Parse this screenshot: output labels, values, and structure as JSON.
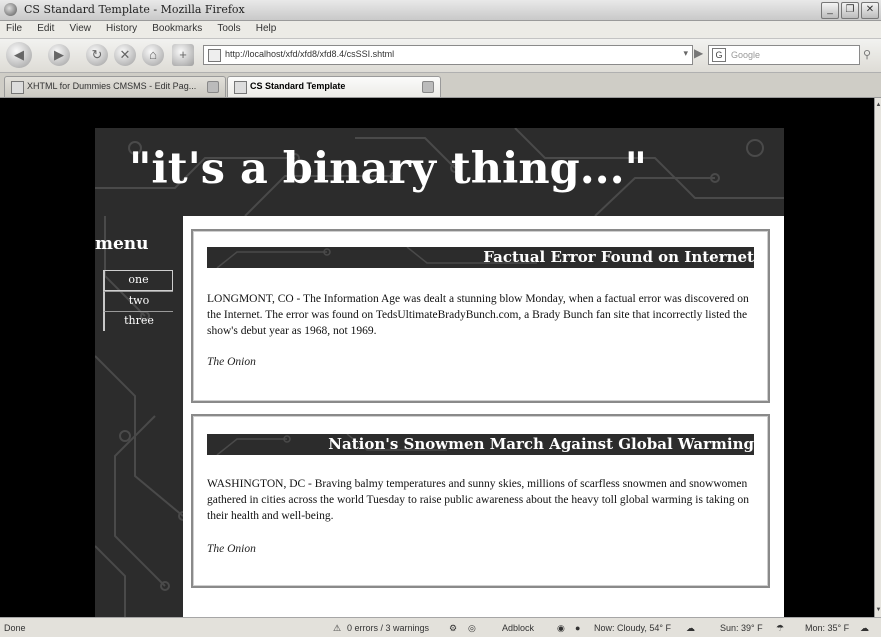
{
  "window": {
    "title": "CS Standard Template - Mozilla Firefox"
  },
  "menubar": [
    "File",
    "Edit",
    "View",
    "History",
    "Bookmarks",
    "Tools",
    "Help"
  ],
  "navigation": {
    "url": "http://localhost/xfd/xfd8/xfd8.4/csSSI.shtml",
    "search_placeholder": "Google",
    "search_engine_icon": "G"
  },
  "tabs": [
    {
      "label": "XHTML for Dummies CMSMS - Edit Pag...",
      "active": false
    },
    {
      "label": "CS Standard Template",
      "active": true
    }
  ],
  "page": {
    "headline": "\"it's a binary thing...\"",
    "menu_heading": "menu",
    "menu_items": [
      "one",
      "two",
      "three"
    ],
    "articles": [
      {
        "title": "Factual Error Found on Internet",
        "body": "LONGMONT, CO - The Information Age was dealt a stunning blow Monday, when a factual error was discovered on the Internet. The error was found on TedsUltimateBradyBunch.com, a Brady Bunch fan site that incorrectly listed the show's debut year as 1968, not 1969.",
        "source": "The Onion"
      },
      {
        "title": "Nation's Snowmen March Against Global Warming",
        "body": "WASHINGTON, DC - Braving balmy temperatures and sunny skies, millions of scarfless snowmen and snowwomen gathered in cities across the world Tuesday to raise public awareness about the heavy toll global warming is taking on their health and well-being.",
        "source": "The Onion"
      }
    ]
  },
  "statusbar": {
    "status": "Done",
    "errors": "0 errors / 3 warnings",
    "adblock": "Adblock",
    "weather_now": "Now: Cloudy, 54° F",
    "weather_sun": "Sun: 39° F",
    "weather_mon": "Mon: 35° F"
  }
}
